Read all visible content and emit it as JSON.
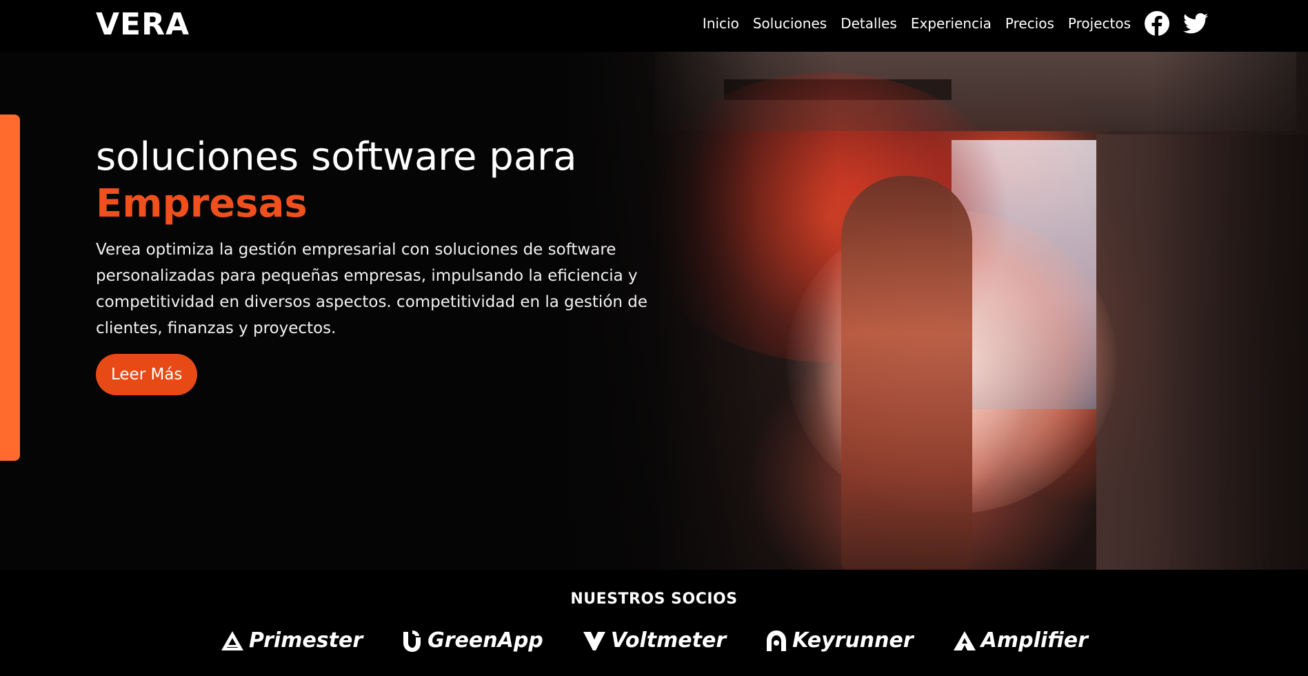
{
  "header": {
    "logo": "VERA",
    "nav": [
      "Inicio",
      "Soluciones",
      "Detalles",
      "Experiencia",
      "Precios",
      "Projectos"
    ],
    "social": [
      "facebook-icon",
      "twitter-icon"
    ]
  },
  "hero": {
    "title_line": "soluciones software para",
    "title_accent": "Empresas",
    "description": "Verea optimiza la gestión empresarial con soluciones de software personalizadas para pequeñas empresas, impulsando la eficiencia y competitividad en diversos aspectos. competitividad en la gestión de clientes, finanzas y proyectos.",
    "cta_label": "Leer Más"
  },
  "partners": {
    "title": "NUESTROS SOCIOS",
    "items": [
      "Primester",
      "GreenApp",
      "Voltmeter",
      "Keyrunner",
      "Amplifier"
    ]
  },
  "colors": {
    "accent": "#f0501e",
    "button": "#e84a16",
    "side_bar": "#ff6b2c",
    "background": "#000000"
  }
}
